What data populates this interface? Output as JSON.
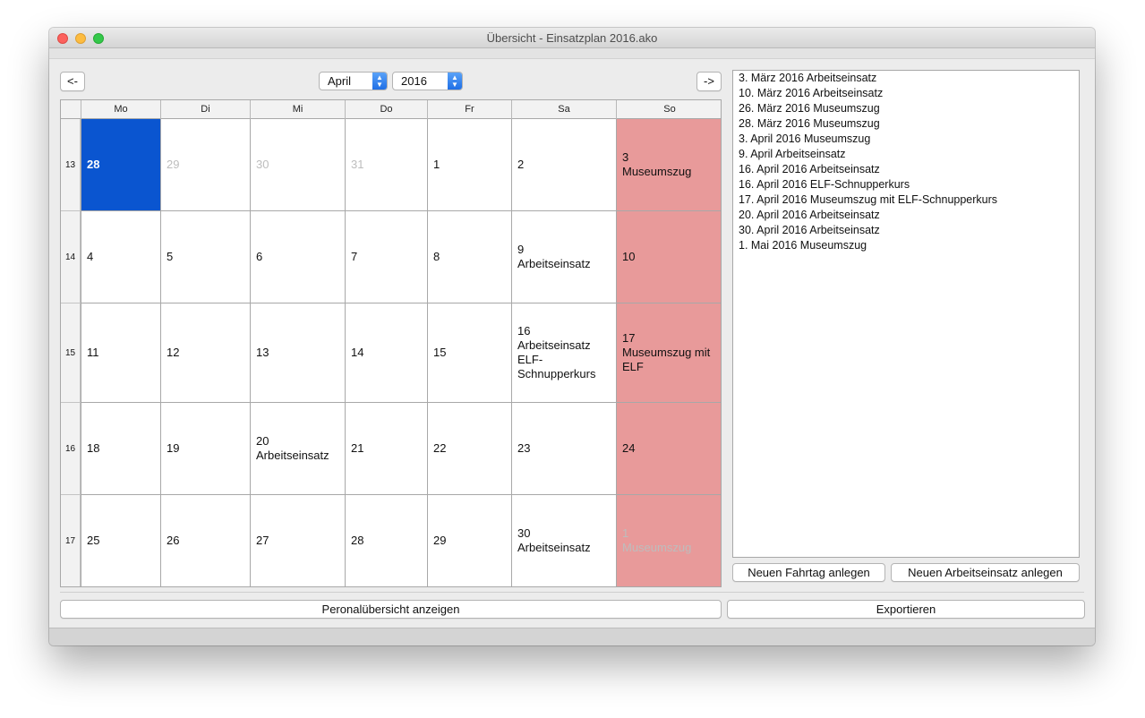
{
  "window": {
    "title": "Übersicht - Einsatzplan 2016.ako"
  },
  "nav": {
    "prev_label": "<-",
    "next_label": "->",
    "month": "April",
    "year": "2016"
  },
  "calendar": {
    "headers": [
      "Mo",
      "Di",
      "Mi",
      "Do",
      "Fr",
      "Sa",
      "So"
    ],
    "weeks": [
      {
        "week": "13",
        "days": [
          {
            "day": "28",
            "note": "",
            "state": "selected"
          },
          {
            "day": "29",
            "note": "",
            "state": "muted"
          },
          {
            "day": "30",
            "note": "",
            "state": "muted"
          },
          {
            "day": "31",
            "note": "",
            "state": "muted"
          },
          {
            "day": "1",
            "note": "",
            "state": "normal"
          },
          {
            "day": "2",
            "note": "",
            "state": "normal"
          },
          {
            "day": "3",
            "note": "Museumszug",
            "state": "normal"
          }
        ]
      },
      {
        "week": "14",
        "days": [
          {
            "day": "4",
            "note": "",
            "state": "normal"
          },
          {
            "day": "5",
            "note": "",
            "state": "normal"
          },
          {
            "day": "6",
            "note": "",
            "state": "normal"
          },
          {
            "day": "7",
            "note": "",
            "state": "normal"
          },
          {
            "day": "8",
            "note": "",
            "state": "normal"
          },
          {
            "day": "9",
            "note": "Arbeitseinsatz",
            "state": "normal"
          },
          {
            "day": "10",
            "note": "",
            "state": "normal"
          }
        ]
      },
      {
        "week": "15",
        "days": [
          {
            "day": "11",
            "note": "",
            "state": "normal"
          },
          {
            "day": "12",
            "note": "",
            "state": "normal"
          },
          {
            "day": "13",
            "note": "",
            "state": "normal"
          },
          {
            "day": "14",
            "note": "",
            "state": "normal"
          },
          {
            "day": "15",
            "note": "",
            "state": "normal"
          },
          {
            "day": "16",
            "note": "Arbeitseinsatz\nELF-\nSchnupperkurs",
            "state": "normal"
          },
          {
            "day": "17",
            "note": "Museumszug mit\nELF",
            "state": "normal"
          }
        ]
      },
      {
        "week": "16",
        "days": [
          {
            "day": "18",
            "note": "",
            "state": "normal"
          },
          {
            "day": "19",
            "note": "",
            "state": "normal"
          },
          {
            "day": "20",
            "note": "Arbeitseinsatz",
            "state": "normal"
          },
          {
            "day": "21",
            "note": "",
            "state": "normal"
          },
          {
            "day": "22",
            "note": "",
            "state": "normal"
          },
          {
            "day": "23",
            "note": "",
            "state": "normal"
          },
          {
            "day": "24",
            "note": "",
            "state": "normal"
          }
        ]
      },
      {
        "week": "17",
        "days": [
          {
            "day": "25",
            "note": "",
            "state": "normal"
          },
          {
            "day": "26",
            "note": "",
            "state": "normal"
          },
          {
            "day": "27",
            "note": "",
            "state": "normal"
          },
          {
            "day": "28",
            "note": "",
            "state": "normal"
          },
          {
            "day": "29",
            "note": "",
            "state": "normal"
          },
          {
            "day": "30",
            "note": "Arbeitseinsatz",
            "state": "normal"
          },
          {
            "day": "1",
            "note": "Museumszug",
            "state": "muted"
          }
        ]
      }
    ]
  },
  "events": [
    "3. März 2016 Arbeitseinsatz",
    "10. März 2016 Arbeitseinsatz",
    "26. März 2016 Museumszug",
    "28. März 2016 Museumszug",
    "3. April 2016 Museumszug",
    "9. April Arbeitseinsatz",
    "16. April 2016 Arbeitseinsatz",
    "16. April 2016 ELF-Schnupperkurs",
    "17. April 2016 Museumszug mit ELF-Schnupperkurs",
    "20. April 2016 Arbeitseinsatz",
    "30. April 2016 Arbeitseinsatz",
    "1. Mai 2016 Museumszug"
  ],
  "buttons": {
    "new_trip": "Neuen Fahrtag anlegen",
    "new_work": "Neuen Arbeitseinsatz anlegen",
    "personnel": "Peronalübersicht anzeigen",
    "export": "Exportieren"
  },
  "colors": {
    "selected": "#0a55d0",
    "sunday": "#e89a9a",
    "muted_text": "#bdbdbd"
  }
}
